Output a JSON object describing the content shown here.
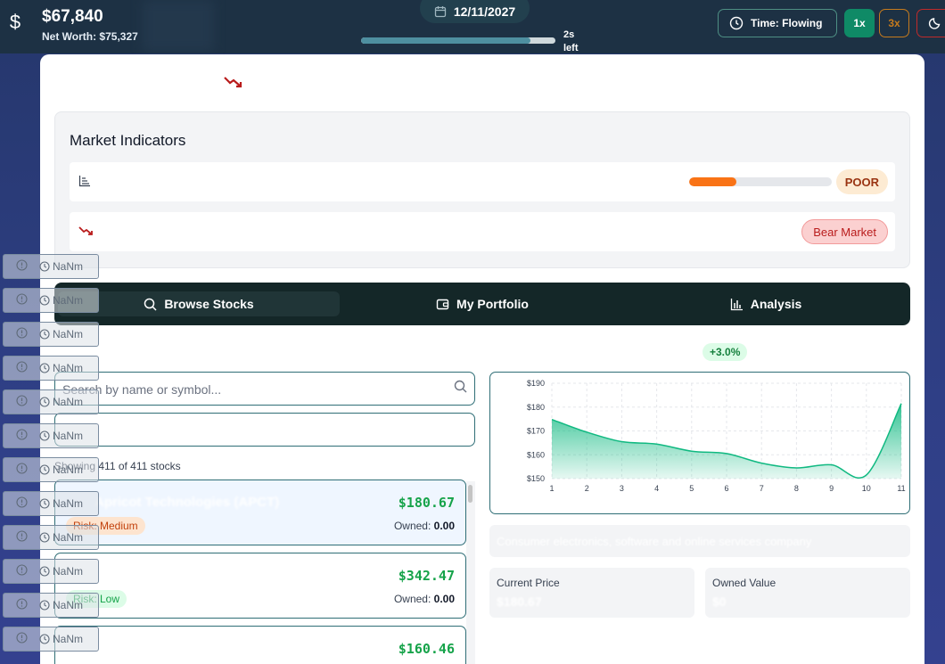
{
  "header": {
    "dollar_icon": "dollar-sign-icon",
    "cash": "$67,840",
    "net_worth": "Net Worth: $75,327",
    "date": "12/11/2027",
    "time_left": "2s left",
    "progress_fraction": 0.87,
    "time_mode": "Time: Flowing",
    "speeds": [
      "1x",
      "3x"
    ],
    "active_speed": "1x"
  },
  "market": {
    "title": "Market Indicators",
    "health_fraction": 0.33,
    "health_status": "POOR",
    "trend_status": "Bear Market"
  },
  "tabs": [
    {
      "label": "Browse Stocks",
      "icon": "search-icon"
    },
    {
      "label": "My Portfolio",
      "icon": "wallet-icon"
    },
    {
      "label": "Analysis",
      "icon": "bar-chart-icon"
    }
  ],
  "search": {
    "placeholder": "Search by name or symbol..."
  },
  "list": {
    "showing": "Showing 411 of 411 stocks",
    "stocks": [
      {
        "name": "Apricot Technologies (APCT)",
        "price": "$180.67",
        "owned_label": "Owned:",
        "owned": "0.00",
        "risk": "Risk: Medium"
      },
      {
        "name": "",
        "price": "$342.47",
        "owned_label": "Owned:",
        "owned": "0.00",
        "risk": "Risk: Low"
      },
      {
        "name": "",
        "price": "$160.46"
      }
    ]
  },
  "detail": {
    "change": "+3.0%",
    "description": "Consumer electronics, software and online services company",
    "current_price_label": "Current Price",
    "current_price": "$180.67",
    "owned_value_label": "Owned Value",
    "owned_value": "$0"
  },
  "chart_data": {
    "type": "area",
    "x": [
      1,
      2,
      3,
      4,
      5,
      6,
      7,
      8,
      9,
      10,
      11
    ],
    "values": [
      174.8,
      169.5,
      165.5,
      164.5,
      161.5,
      160.5,
      156.5,
      154.5,
      155.8,
      151.5,
      181.5
    ],
    "yticks": [
      150,
      160,
      170,
      180,
      190
    ],
    "ytick_labels": [
      "$150",
      "$160",
      "$170",
      "$180",
      "$190"
    ],
    "ylim": [
      150,
      190
    ],
    "grid": true,
    "color": "#10b981"
  },
  "ghost_rows": {
    "label": "NaNm",
    "count": 12
  }
}
